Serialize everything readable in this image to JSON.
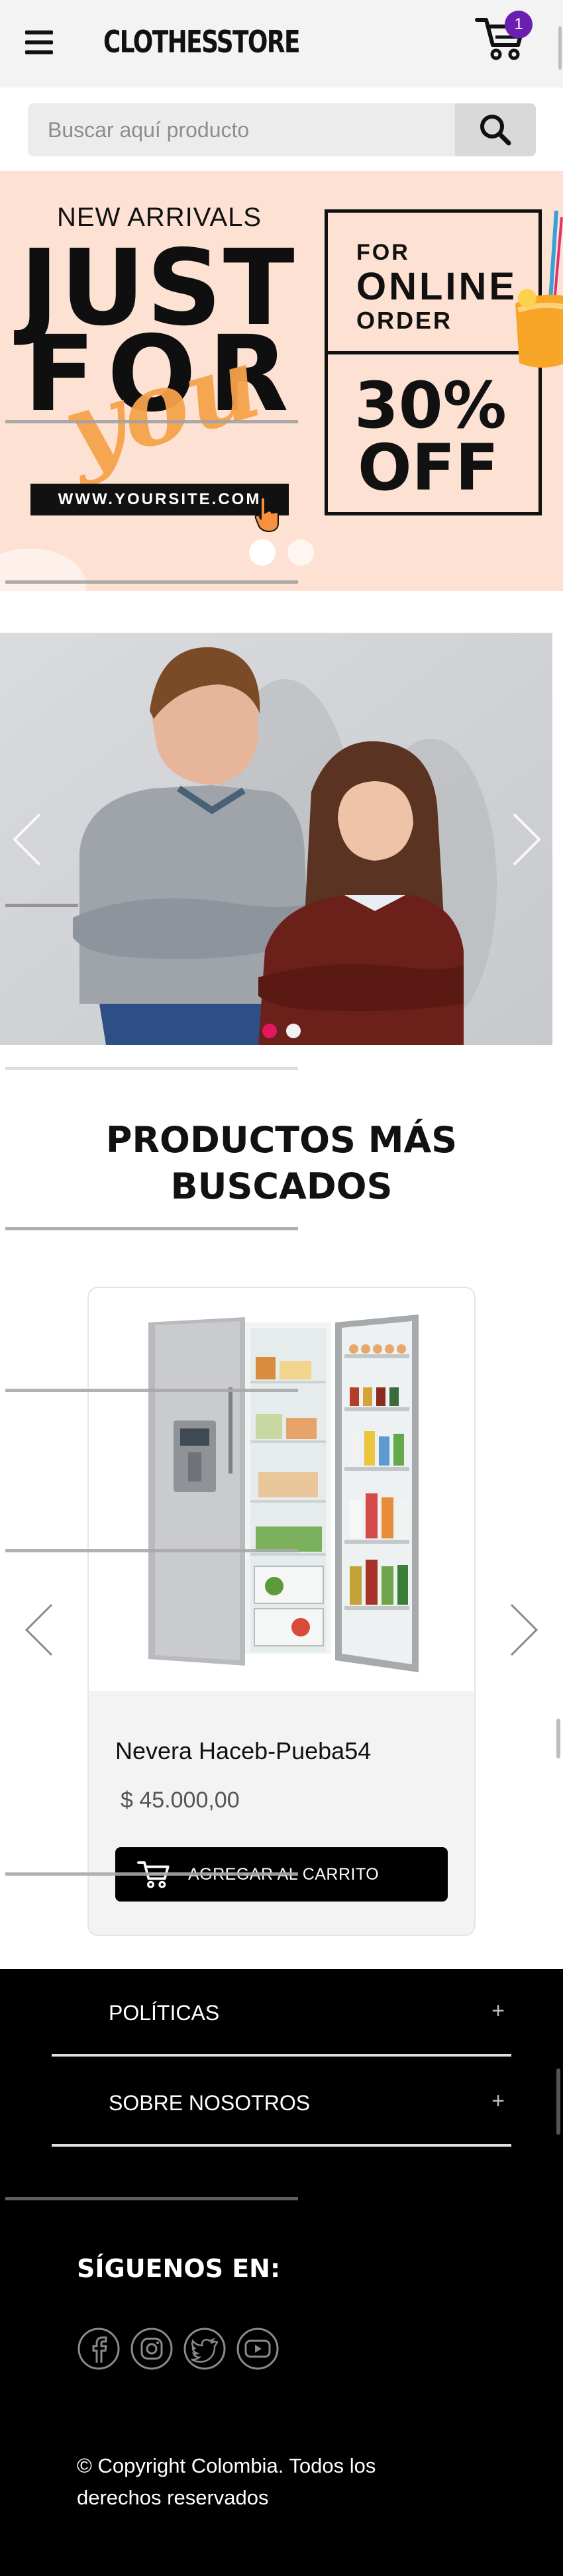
{
  "header": {
    "brand": "CLOTHESSTORE",
    "cart_count": "1",
    "menu_icon": "hamburger-icon",
    "cart_icon": "cart-icon"
  },
  "search": {
    "placeholder": "Buscar aquí producto",
    "value": "",
    "button_icon": "search-icon"
  },
  "promo_banner": {
    "new_arrivals": "NEW ARRIVALS",
    "just": "JUST",
    "for": "FOR",
    "you": "you",
    "website": "WWW.YOURSITE.COM",
    "for_small": "FOR",
    "online": "ONLINE",
    "order": "ORDER",
    "discount": "30%",
    "off": "OFF",
    "background_color": "#fde1d2",
    "slides": 2,
    "active_slide": 1
  },
  "kids_slider": {
    "slides": 2,
    "active_slide": 1,
    "active_dot_color": "#e4165f",
    "prev_icon": "chevron-left-icon",
    "next_icon": "chevron-right-icon"
  },
  "section": {
    "title_line1": "PRODUCTOS MÁS",
    "title_line2": "BUSCADOS"
  },
  "product": {
    "name": "Nevera Haceb-Pueba54",
    "price": "$ 45.000,00",
    "add_to_cart": "AGREGAR AL CARRITO",
    "cart_icon": "cart-icon"
  },
  "footer": {
    "accordion": [
      {
        "label": "POLÍTICAS",
        "icon": "+"
      },
      {
        "label": "SOBRE NOSOTROS",
        "icon": "+"
      }
    ],
    "follow_title": "SÍGUENOS EN:",
    "social": [
      "facebook-icon",
      "instagram-icon",
      "twitter-icon",
      "youtube-icon"
    ],
    "copyright": "© Copyright Colombia. Todos los derechos reservados"
  },
  "colors": {
    "badge": "#6a1fb0",
    "footer_bg": "#000000",
    "button_bg": "#000000"
  }
}
